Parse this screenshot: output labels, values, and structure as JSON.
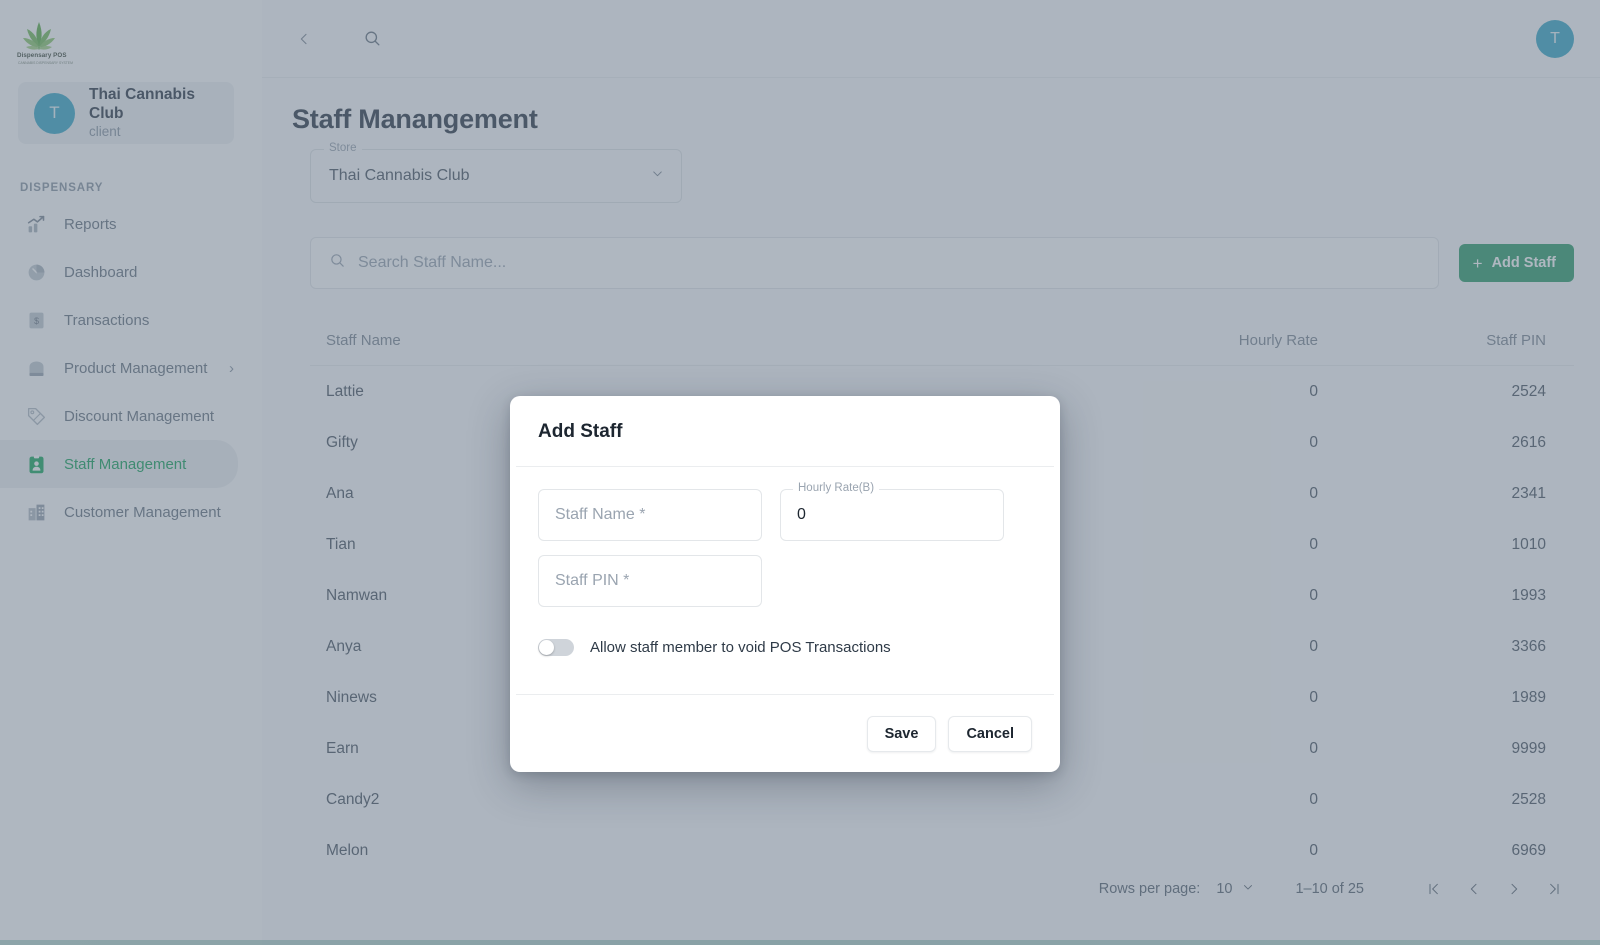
{
  "brand": {
    "logo_name": "cannabis-leaf-logo",
    "logo_text": "Dispensary POS",
    "logo_subtext": "CANNABIS DISPENSARY SYSTEM",
    "accent_green": "#2e9e6b",
    "active_green": "#17a35c",
    "avatar_blue": "#3aa8c6"
  },
  "sidebar": {
    "client": {
      "initial": "T",
      "name": "Thai Cannabis Club",
      "role": "client"
    },
    "section_label": "DISPENSARY",
    "items": [
      {
        "label": "Reports",
        "icon": "chart-trend-icon",
        "active": false,
        "has_caret": false
      },
      {
        "label": "Dashboard",
        "icon": "gauge-icon",
        "active": false,
        "has_caret": false
      },
      {
        "label": "Transactions",
        "icon": "receipt-dollar-icon",
        "active": false,
        "has_caret": false
      },
      {
        "label": "Product Management",
        "icon": "bag-icon",
        "active": false,
        "has_caret": true
      },
      {
        "label": "Discount Management",
        "icon": "tag-percent-icon",
        "active": false,
        "has_caret": false
      },
      {
        "label": "Staff Management",
        "icon": "id-badge-icon",
        "active": true,
        "has_caret": false
      },
      {
        "label": "Customer Management",
        "icon": "building-icon",
        "active": false,
        "has_caret": false
      }
    ],
    "caret_glyph": "›"
  },
  "topbar": {
    "collapse_icon": "chevron-left-icon",
    "collapse_glyph": "‹",
    "search_icon": "search-icon",
    "avatar_initial": "T"
  },
  "page": {
    "title": "Staff Manangement",
    "store_field": {
      "legend": "Store",
      "value": "Thai Cannabis Club",
      "caret": "˅"
    },
    "search": {
      "placeholder": "Search Staff Name...",
      "value": ""
    },
    "add_button": {
      "label": "Add Staff",
      "plus": "+"
    }
  },
  "table": {
    "columns": [
      "Staff Name",
      "Hourly Rate",
      "Staff PIN"
    ],
    "rows": [
      {
        "name": "Lattie",
        "rate": "0",
        "pin": "2524"
      },
      {
        "name": "Gifty",
        "rate": "0",
        "pin": "2616"
      },
      {
        "name": "Ana",
        "rate": "0",
        "pin": "2341"
      },
      {
        "name": "Tian",
        "rate": "0",
        "pin": "1010"
      },
      {
        "name": "Namwan",
        "rate": "0",
        "pin": "1993"
      },
      {
        "name": "Anya",
        "rate": "0",
        "pin": "3366"
      },
      {
        "name": "Ninews",
        "rate": "0",
        "pin": "1989"
      },
      {
        "name": "Earn",
        "rate": "0",
        "pin": "9999"
      },
      {
        "name": "Candy2",
        "rate": "0",
        "pin": "2528"
      },
      {
        "name": "Melon",
        "rate": "0",
        "pin": "6969"
      }
    ]
  },
  "pagination": {
    "rows_per_page_label": "Rows per page:",
    "rows_per_page_value": "10",
    "rows_caret": "˅",
    "range_text": "1–10 of 25",
    "first_glyph": "|‹",
    "prev_glyph": "‹",
    "next_glyph": "›",
    "last_glyph": "›|"
  },
  "modal": {
    "title": "Add Staff",
    "fields": {
      "staff_name": {
        "placeholder": "Staff Name",
        "required_mark": "*",
        "value": ""
      },
      "hourly_rate": {
        "legend": "Hourly Rate(B)",
        "value": "0"
      },
      "staff_pin": {
        "placeholder": "Staff PIN",
        "required_mark": "*",
        "value": ""
      }
    },
    "toggle": {
      "label": "Allow staff member to void POS Transactions",
      "on": false
    },
    "save_label": "Save",
    "cancel_label": "Cancel"
  }
}
